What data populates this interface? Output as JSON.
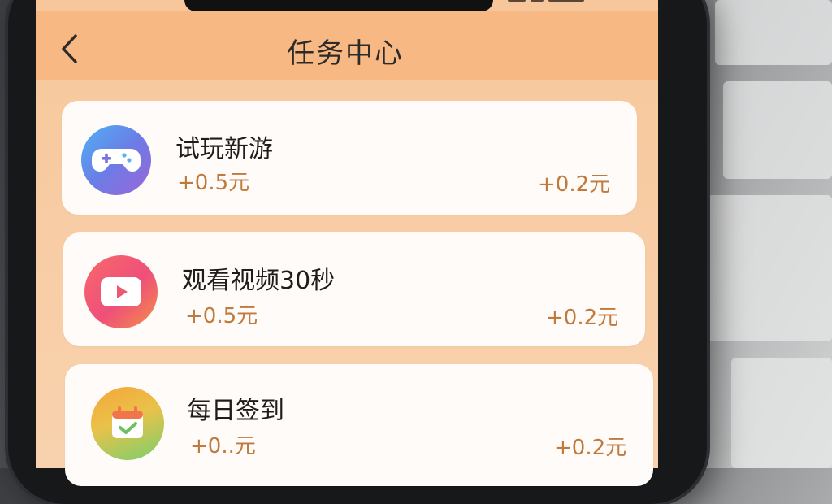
{
  "header": {
    "title": "任务中心"
  },
  "tasks": [
    {
      "name": "试玩新游",
      "reward_left": "+0.5元",
      "reward_right": "+0.2元",
      "icon": "gamepad-icon"
    },
    {
      "name": "观看视频30秒",
      "reward_left": "+0.5元",
      "reward_right": "+0.2元",
      "icon": "play-video-icon"
    },
    {
      "name": "每日签到",
      "reward_left": "+0..元",
      "reward_right": "+0.2元",
      "icon": "calendar-check-icon"
    }
  ],
  "colors": {
    "header_bg": "#f7b884",
    "page_bg": "#f8d2ae",
    "reward_text": "#c07a3c",
    "card_bg": "#fffbf8"
  }
}
